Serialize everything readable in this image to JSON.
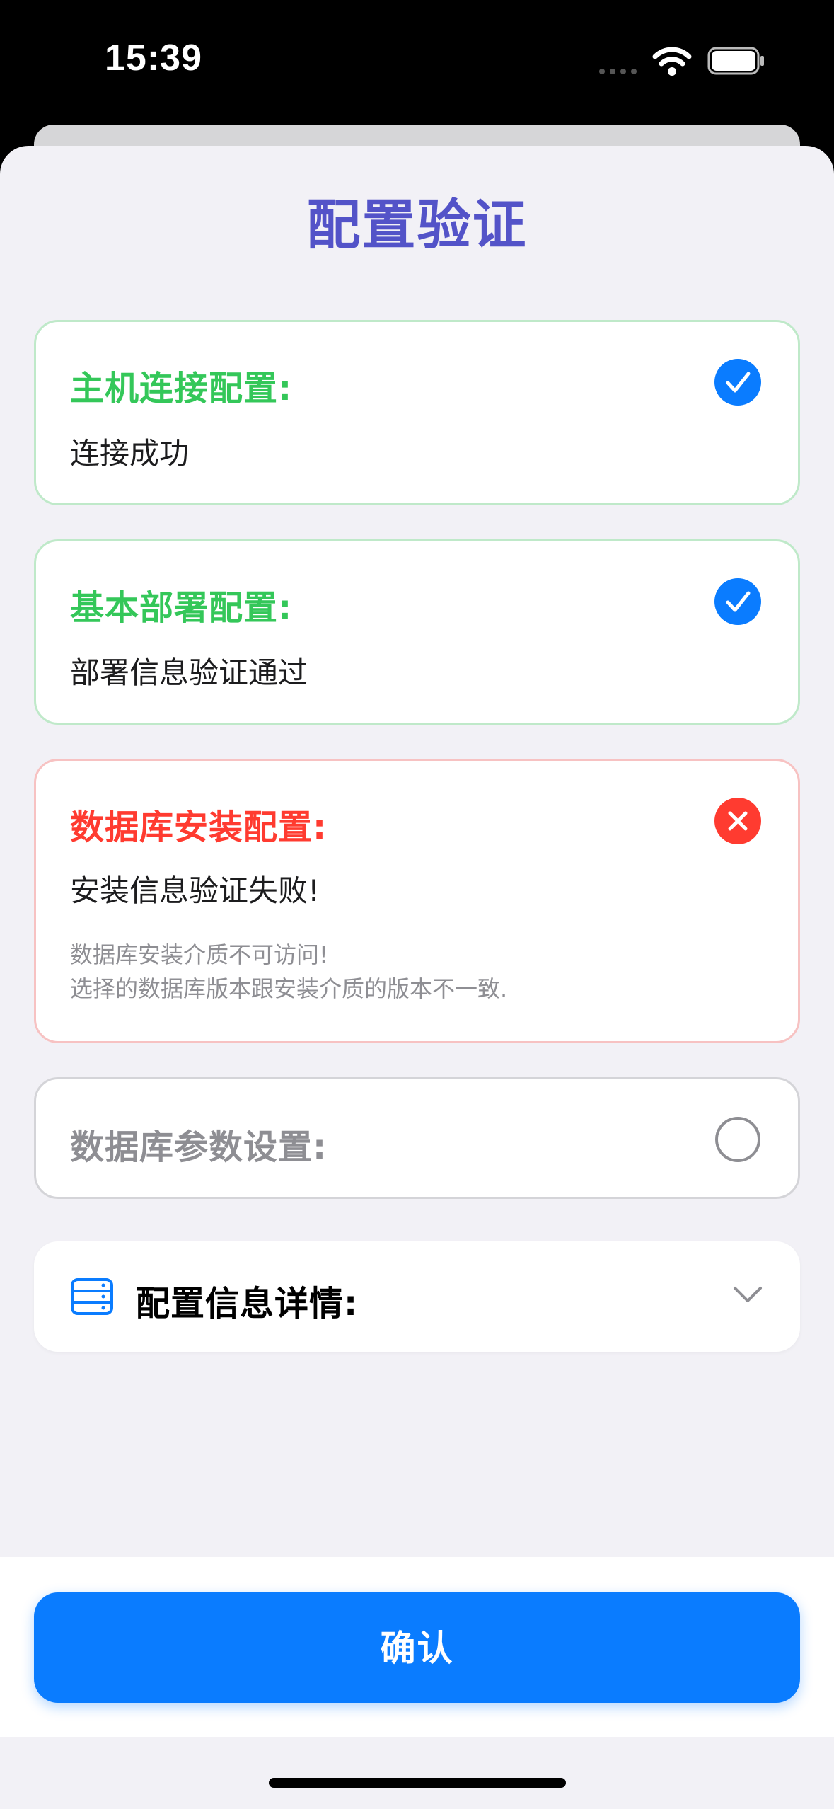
{
  "status_bar": {
    "time": "15:39"
  },
  "sheet": {
    "title": "配置验证"
  },
  "cards": [
    {
      "title": "主机连接配置:",
      "message": "连接成功",
      "status": "success",
      "icon": "check-circle-icon"
    },
    {
      "title": "基本部署配置:",
      "message": "部署信息验证通过",
      "status": "success",
      "icon": "check-circle-icon"
    },
    {
      "title": "数据库安装配置:",
      "message": "安装信息验证失败!",
      "details": [
        "数据库安装介质不可访问!",
        "选择的数据库版本跟安装介质的版本不一致."
      ],
      "status": "failed",
      "icon": "x-circle-icon"
    },
    {
      "title": "数据库参数设置:",
      "status": "pending",
      "icon": "empty-circle-icon"
    }
  ],
  "details_section": {
    "label": "配置信息详情:",
    "icon": "server-icon",
    "expand_icon": "chevron-down-icon"
  },
  "footer": {
    "confirm_label": "确认"
  },
  "colors": {
    "accent": "#0a7cff",
    "title": "#5353c8",
    "success": "#34c759",
    "error": "#ff3b30",
    "pending": "#8e8e93",
    "background": "#f2f1f6"
  }
}
